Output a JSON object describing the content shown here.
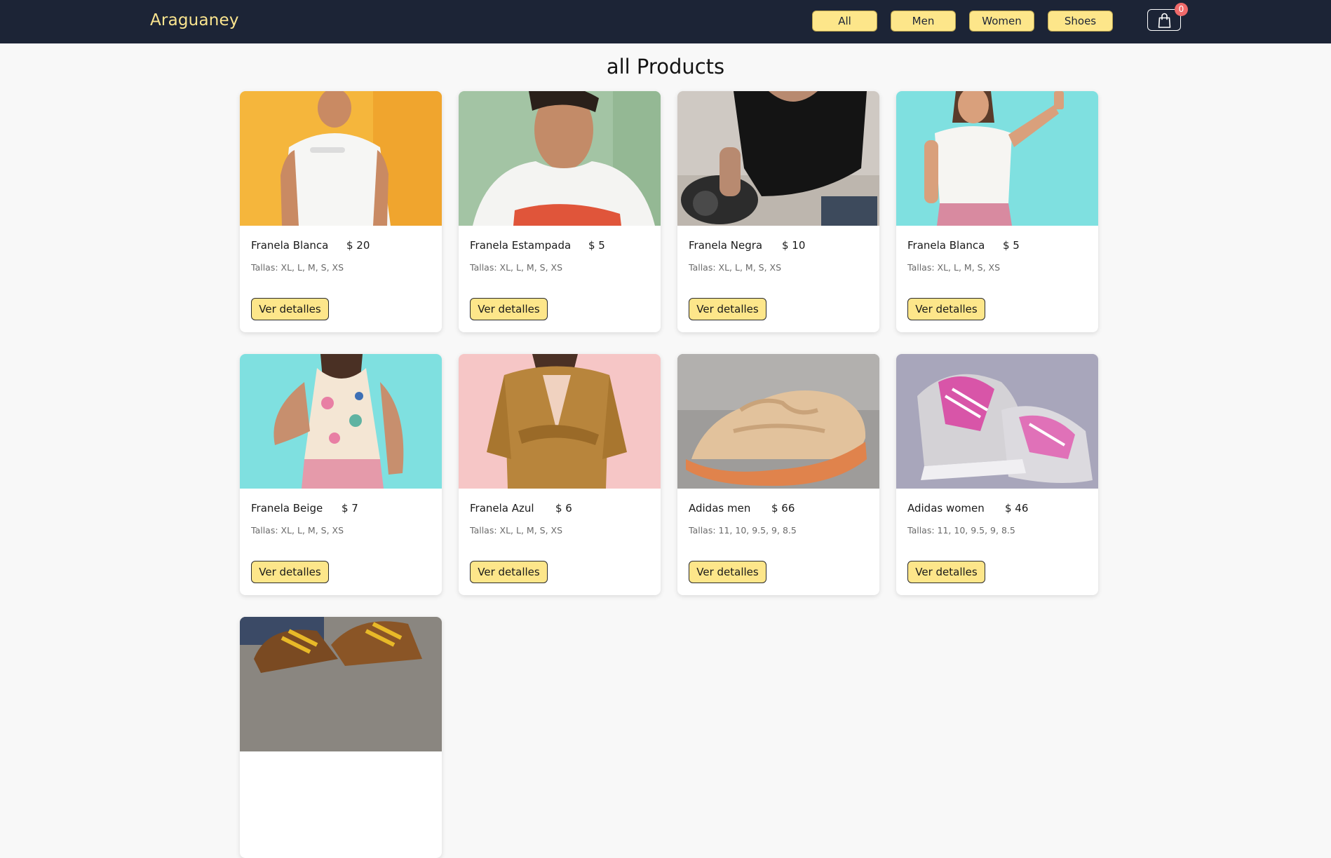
{
  "header": {
    "brand": "Araguaney",
    "filters": [
      "All",
      "Men",
      "Women",
      "Shoes"
    ],
    "cart_count": "0"
  },
  "main": {
    "title": "all Products",
    "products": [
      {
        "name": "Franela Blanca",
        "price": "$ 20",
        "sizes": "Tallas: XL, L, M, S, XS",
        "button": "Ver detalles"
      },
      {
        "name": "Franela Estampada",
        "price": "$ 5",
        "sizes": "Tallas: XL, L, M, S, XS",
        "button": "Ver detalles"
      },
      {
        "name": "Franela Negra",
        "price": "$ 10",
        "sizes": "Tallas: XL, L, M, S, XS",
        "button": "Ver detalles"
      },
      {
        "name": "Franela Blanca",
        "price": "$ 5",
        "sizes": "Tallas: XL, L, M, S, XS",
        "button": "Ver detalles"
      },
      {
        "name": "Franela Beige",
        "price": "$ 7",
        "sizes": "Tallas: XL, L, M, S, XS",
        "button": "Ver detalles"
      },
      {
        "name": "Franela Azul",
        "price": "$ 6",
        "sizes": "Tallas: XL, L, M, S, XS",
        "button": "Ver detalles"
      },
      {
        "name": "Adidas men",
        "price": "$ 66",
        "sizes": "Tallas: 11, 10, 9.5, 9, 8.5",
        "button": "Ver detalles"
      },
      {
        "name": "Adidas women",
        "price": "$ 46",
        "sizes": "Tallas: 11, 10, 9.5, 9, 8.5",
        "button": "Ver detalles"
      }
    ]
  },
  "colors": {
    "navbar": "#1c2436",
    "accent": "#fde68a",
    "brand_text": "#fbe58f",
    "badge": "#f06a6a"
  },
  "icons": {
    "cart": "shopping-bag-icon"
  }
}
